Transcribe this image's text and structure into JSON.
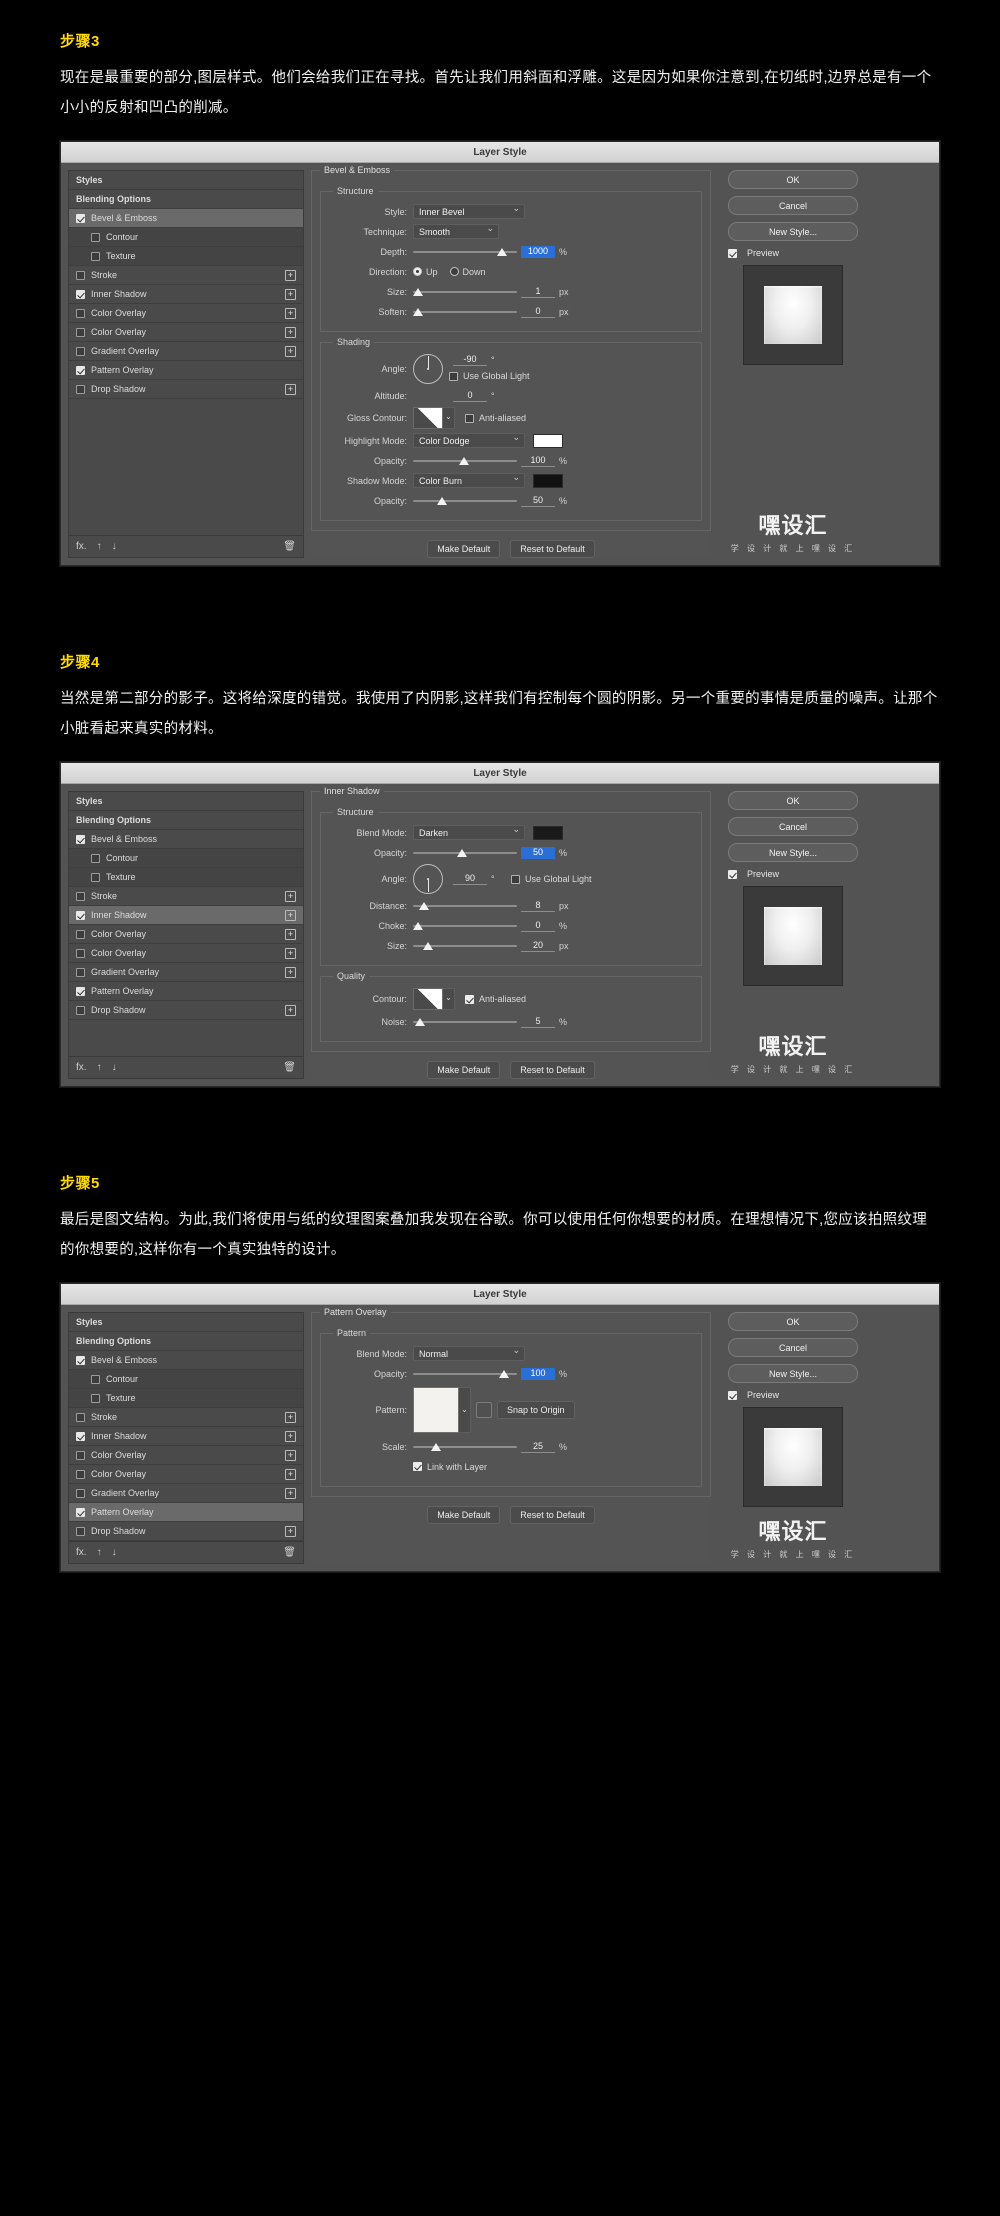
{
  "steps": [
    {
      "title": "步骤3",
      "paragraph": "现在是最重要的部分,图层样式。他们会给我们正在寻找。首先让我们用斜面和浮雕。这是因为如果你注意到,在切纸时,边界总是有一个小小的反射和凹凸的削减。"
    },
    {
      "title": "步骤4",
      "paragraph": "当然是第二部分的影子。这将给深度的错觉。我使用了内阴影,这样我们有控制每个圆的阴影。另一个重要的事情是质量的噪声。让那个小脏看起来真实的材料。"
    },
    {
      "title": "步骤5",
      "paragraph": "最后是图文结构。为此,我们将使用与纸的纹理图案叠加我发现在谷歌。你可以使用任何你想要的材质。在理想情况下,您应该拍照纹理的你想要的,这样你有一个真实独特的设计。"
    }
  ],
  "dialog": {
    "title": "Layer Style",
    "fx_list": [
      {
        "label": "Styles",
        "checkbox": "none",
        "checked": false,
        "plus": false,
        "selected": false,
        "sub": false
      },
      {
        "label": "Blending Options",
        "checkbox": "none",
        "checked": false,
        "plus": false,
        "selected": false,
        "sub": false
      },
      {
        "label": "Bevel & Emboss",
        "checkbox": "yes",
        "checked": true,
        "plus": false,
        "selected": false,
        "sub": false
      },
      {
        "label": "Contour",
        "checkbox": "yes",
        "checked": false,
        "plus": false,
        "selected": false,
        "sub": true
      },
      {
        "label": "Texture",
        "checkbox": "yes",
        "checked": false,
        "plus": false,
        "selected": false,
        "sub": true
      },
      {
        "label": "Stroke",
        "checkbox": "yes",
        "checked": false,
        "plus": true,
        "selected": false,
        "sub": false
      },
      {
        "label": "Inner Shadow",
        "checkbox": "yes",
        "checked": true,
        "plus": true,
        "selected": false,
        "sub": false
      },
      {
        "label": "Color Overlay",
        "checkbox": "yes",
        "checked": false,
        "plus": true,
        "selected": false,
        "sub": false
      },
      {
        "label": "Color Overlay",
        "checkbox": "yes",
        "checked": false,
        "plus": true,
        "selected": false,
        "sub": false
      },
      {
        "label": "Gradient Overlay",
        "checkbox": "yes",
        "checked": false,
        "plus": true,
        "selected": false,
        "sub": false
      },
      {
        "label": "Pattern Overlay",
        "checkbox": "yes",
        "checked": true,
        "plus": false,
        "selected": false,
        "sub": false
      },
      {
        "label": "Drop Shadow",
        "checkbox": "yes",
        "checked": false,
        "plus": true,
        "selected": false,
        "sub": false
      }
    ],
    "footer_icons": {
      "fx": "fx.",
      "up": "↑",
      "down": "↓",
      "trash": "🗑"
    },
    "buttons": {
      "ok": "OK",
      "cancel": "Cancel",
      "new_style": "New Style...",
      "preview": "Preview",
      "make_default": "Make Default",
      "reset_to_default": "Reset to Default"
    },
    "watermark": {
      "main": "嘿设汇",
      "sub": "学 设 计 就 上 嘿 设 汇"
    }
  },
  "panel_bevel": {
    "group_label": "Bevel & Emboss",
    "structure_label": "Structure",
    "shading_label": "Shading",
    "rows": {
      "style_label": "Style:",
      "style_value": "Inner Bevel",
      "technique_label": "Technique:",
      "technique_value": "Smooth",
      "depth_label": "Depth:",
      "depth_value": "1000",
      "depth_unit": "%",
      "direction_label": "Direction:",
      "direction_up": "Up",
      "direction_down": "Down",
      "size_label": "Size:",
      "size_value": "1",
      "size_unit": "px",
      "soften_label": "Soften:",
      "soften_value": "0",
      "soften_unit": "px",
      "angle_label": "Angle:",
      "angle_value": "-90",
      "angle_unit": "°",
      "use_global_light": "Use Global Light",
      "altitude_label": "Altitude:",
      "altitude_value": "0",
      "altitude_unit": "°",
      "gloss_contour_label": "Gloss Contour:",
      "anti_aliased": "Anti-aliased",
      "highlight_mode_label": "Highlight Mode:",
      "highlight_mode_value": "Color Dodge",
      "highlight_color": "#ffffff",
      "highlight_opacity_label": "Opacity:",
      "highlight_opacity_value": "100",
      "highlight_opacity_unit": "%",
      "shadow_mode_label": "Shadow Mode:",
      "shadow_mode_value": "Color Burn",
      "shadow_color": "#111111",
      "shadow_opacity_label": "Opacity:",
      "shadow_opacity_value": "50",
      "shadow_opacity_unit": "%"
    }
  },
  "panel_inner_shadow": {
    "group_label": "Inner Shadow",
    "structure_label": "Structure",
    "quality_label": "Quality",
    "rows": {
      "blend_mode_label": "Blend Mode:",
      "blend_mode_value": "Darken",
      "blend_color": "#1a1a1a",
      "opacity_label": "Opacity:",
      "opacity_value": "50",
      "opacity_unit": "%",
      "angle_label": "Angle:",
      "angle_value": "90",
      "angle_unit": "°",
      "use_global_light": "Use Global Light",
      "distance_label": "Distance:",
      "distance_value": "8",
      "distance_unit": "px",
      "choke_label": "Choke:",
      "choke_value": "0",
      "choke_unit": "%",
      "size_label": "Size:",
      "size_value": "20",
      "size_unit": "px",
      "contour_label": "Contour:",
      "anti_aliased": "Anti-aliased",
      "noise_label": "Noise:",
      "noise_value": "5",
      "noise_unit": "%"
    }
  },
  "panel_pattern": {
    "group_label": "Pattern Overlay",
    "pattern_label": "Pattern",
    "rows": {
      "blend_mode_label": "Blend Mode:",
      "blend_mode_value": "Normal",
      "opacity_label": "Opacity:",
      "opacity_value": "100",
      "opacity_unit": "%",
      "pattern_label": "Pattern:",
      "snap_to_origin": "Snap to Origin",
      "scale_label": "Scale:",
      "scale_value": "25",
      "scale_unit": "%",
      "link_with_layer": "Link with Layer"
    }
  }
}
